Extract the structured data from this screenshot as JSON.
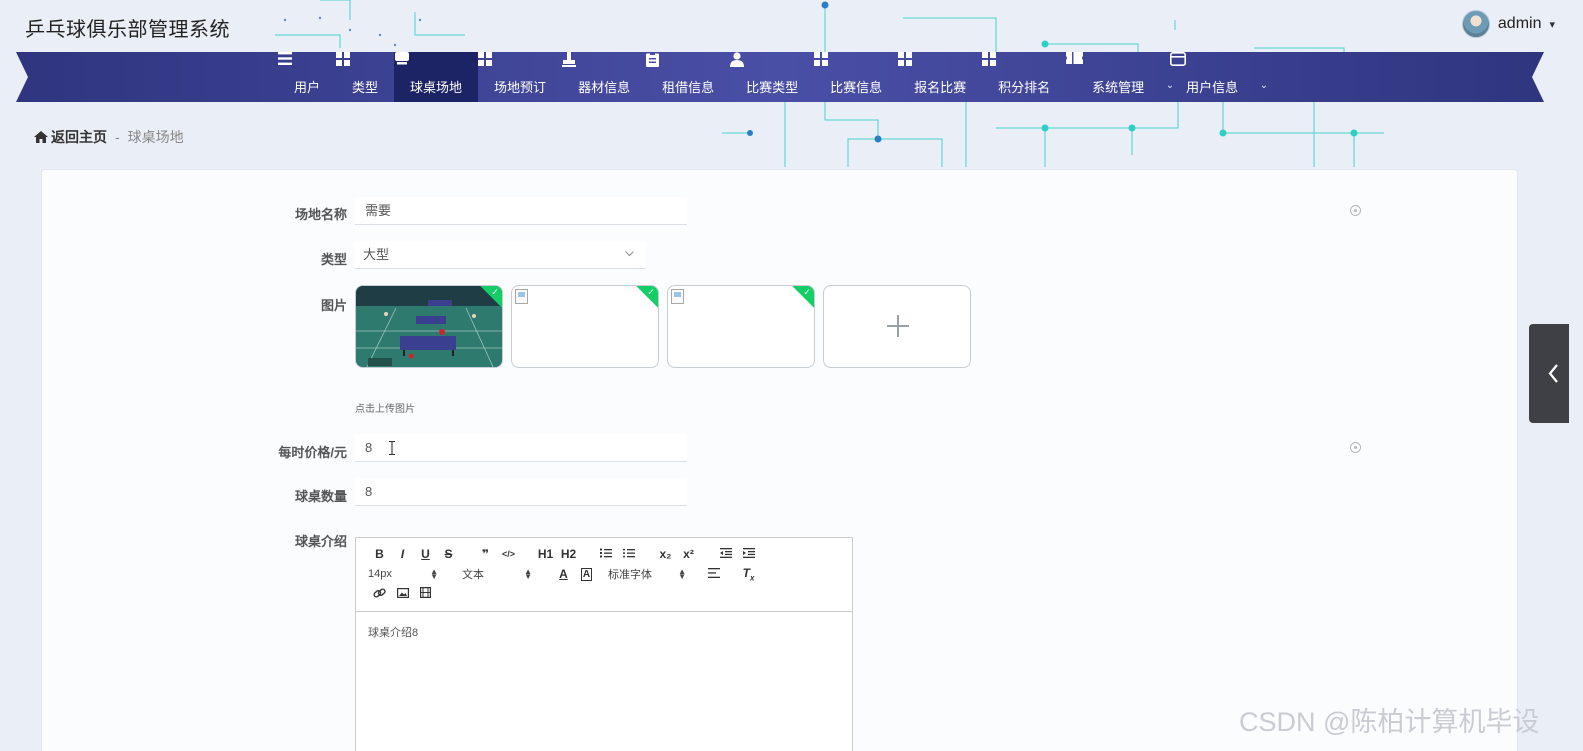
{
  "app": {
    "title": "乒乓球俱乐部管理系统"
  },
  "user": {
    "name": "admin",
    "caret": "▾"
  },
  "nav": {
    "items": [
      {
        "label": "用户",
        "icon": "list-icon"
      },
      {
        "label": "类型",
        "icon": "grid-icon"
      },
      {
        "label": "球桌场地",
        "icon": "table-tennis-icon",
        "active": true
      },
      {
        "label": "场地预订",
        "icon": "grid-icon"
      },
      {
        "label": "器材信息",
        "icon": "stamp-icon"
      },
      {
        "label": "租借信息",
        "icon": "clipboard-icon"
      },
      {
        "label": "比赛类型",
        "icon": "person-icon"
      },
      {
        "label": "比赛信息",
        "icon": "grid-icon"
      },
      {
        "label": "报名比赛",
        "icon": "grid-icon"
      },
      {
        "label": "积分排名",
        "icon": "grid-icon"
      },
      {
        "label": "系统管理",
        "icon": "ticket-icon",
        "dropdown": true
      },
      {
        "label": "用户信息",
        "icon": "card-icon",
        "dropdown": true
      }
    ]
  },
  "breadcrumb": {
    "home": "返回主页",
    "separator": "-",
    "current": "球桌场地"
  },
  "form": {
    "venue_name": {
      "label": "场地名称",
      "value": "需要"
    },
    "type": {
      "label": "类型",
      "value": "大型"
    },
    "images": {
      "label": "图片",
      "tip": "点击上传图片",
      "count": 3,
      "add_icon": "plus-icon"
    },
    "price": {
      "label": "每时价格/元",
      "value": "8"
    },
    "table_count": {
      "label": "球桌数量",
      "value": "8"
    },
    "intro": {
      "label": "球桌介绍",
      "content": "球桌介绍8",
      "toolbar": {
        "row1": [
          "B",
          "I",
          "U",
          "S",
          "❞",
          "</>",
          "H1",
          "H2",
          "ol",
          "ul",
          "x₂",
          "x²",
          "outdent",
          "indent"
        ],
        "size": "14px",
        "header": "文本",
        "font": "标准字体"
      }
    }
  },
  "watermark": "CSDN @陈柏计算机毕设",
  "colors": {
    "nav_bg": "#3a3f92",
    "nav_active": "#1c2465",
    "success": "#13ce66",
    "circuit": "#2ecfc4"
  }
}
